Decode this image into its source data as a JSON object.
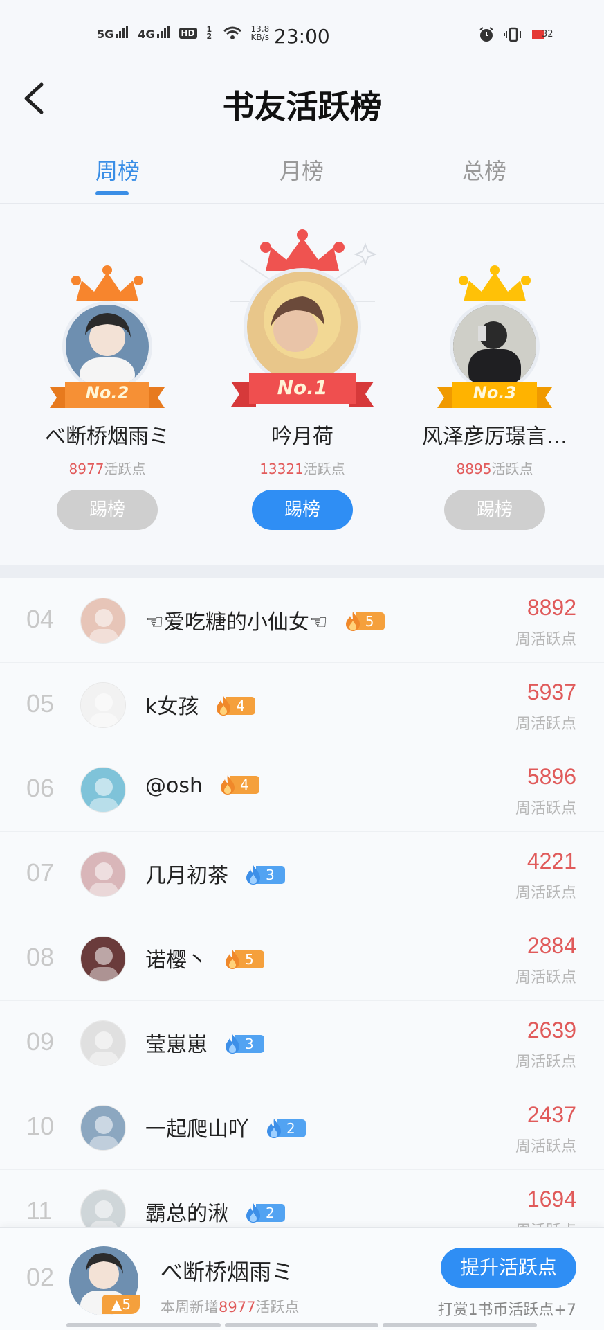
{
  "status_bar": {
    "net1": "5G",
    "net2": "4G",
    "hd": "HD",
    "hd_sub": "1 2",
    "speed": "13.8",
    "speed_unit": "KB/s",
    "time": "23:00",
    "battery": "32"
  },
  "header": {
    "title": "书友活跃榜"
  },
  "tabs": [
    {
      "label": "周榜",
      "active": true
    },
    {
      "label": "月榜",
      "active": false
    },
    {
      "label": "总榜",
      "active": false
    }
  ],
  "podium": {
    "first": {
      "rank_badge": "No.1",
      "name": "吟月荷",
      "points": "13321",
      "points_suffix": "活跃点",
      "button": "踢榜",
      "crown_color": "#ef5350",
      "ribbon_color": "#ef4f4f",
      "avatar_color": "#e8c68a"
    },
    "second": {
      "rank_badge": "No.2",
      "name": "べ断桥烟雨ミ",
      "points": "8977",
      "points_suffix": "活跃点",
      "button": "踢榜",
      "crown_color": "#f7852d",
      "ribbon_color": "#f69035",
      "avatar_color": "#6e8fb0"
    },
    "third": {
      "rank_badge": "No.3",
      "name": "风泽彦厉璟言…",
      "points": "8895",
      "points_suffix": "活跃点",
      "button": "踢榜",
      "crown_color": "#ffc107",
      "ribbon_color": "#ffb300",
      "avatar_color": "#3f3f46"
    }
  },
  "list": [
    {
      "rank": "04",
      "name": "☜爱吃糖的小仙女☜",
      "level": "5",
      "badge": "orange",
      "score": "8892",
      "score_label": "周活跃点",
      "avatar_color": "#e7c5b8"
    },
    {
      "rank": "05",
      "name": "k女孩",
      "level": "4",
      "badge": "orange",
      "score": "5937",
      "score_label": "周活跃点",
      "avatar_color": "#f2f2f2"
    },
    {
      "rank": "06",
      "name": "@osh",
      "level": "4",
      "badge": "orange",
      "score": "5896",
      "score_label": "周活跃点",
      "avatar_color": "#7fc3d9"
    },
    {
      "rank": "07",
      "name": "几月初茶",
      "level": "3",
      "badge": "blue",
      "score": "4221",
      "score_label": "周活跃点",
      "avatar_color": "#d9b6b9"
    },
    {
      "rank": "08",
      "name": "诺樱丶",
      "level": "5",
      "badge": "orange",
      "score": "2884",
      "score_label": "周活跃点",
      "avatar_color": "#6a3b3b"
    },
    {
      "rank": "09",
      "name": "莹崽崽",
      "level": "3",
      "badge": "blue",
      "score": "2639",
      "score_label": "周活跃点",
      "avatar_color": "#e0e0e0"
    },
    {
      "rank": "10",
      "name": "一起爬山吖",
      "level": "2",
      "badge": "blue",
      "score": "2437",
      "score_label": "周活跃点",
      "avatar_color": "#8ca7c0"
    },
    {
      "rank": "11",
      "name": "霸总的湫",
      "level": "2",
      "badge": "blue",
      "score": "1694",
      "score_label": "周活跃点",
      "avatar_color": "#cfd6d9"
    }
  ],
  "my_rank": {
    "rank": "02",
    "name": "べ断桥烟雨ミ",
    "level": "5",
    "sub_prefix": "本周新增",
    "sub_value": "8977",
    "sub_suffix": "活跃点",
    "button": "提升活跃点",
    "tip": "打赏1书币活跃点+7"
  }
}
